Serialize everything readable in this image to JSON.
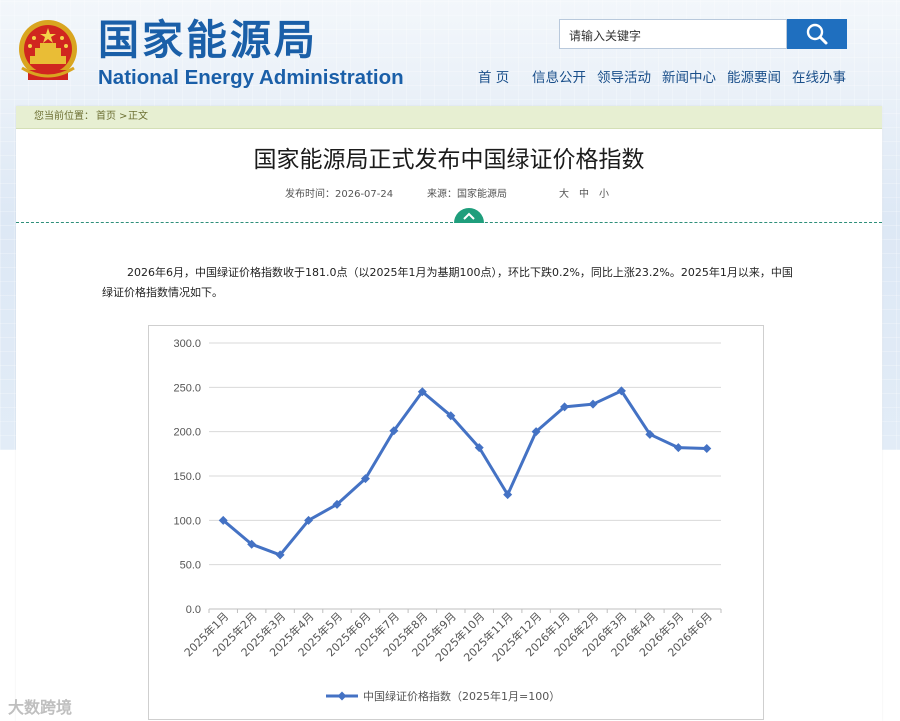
{
  "header": {
    "title_cn": "国家能源局",
    "title_en": "National Energy Administration",
    "emblem_icon": "national-emblem-icon",
    "search": {
      "placeholder": "请输入关键字",
      "button_icon": "search-icon"
    },
    "nav": [
      "首 页",
      "信息公开",
      "领导活动",
      "新闻中心",
      "能源要闻",
      "在线办事"
    ]
  },
  "breadcrumb": {
    "label": "您当前位置：",
    "items": [
      "首页",
      ">",
      "正文"
    ]
  },
  "article": {
    "title": "国家能源局正式发布中国绿证价格指数",
    "publish_time": "发布时间：2026-07-24",
    "source": "来源：国家能源局",
    "font_sizes": [
      "大",
      "中",
      "小"
    ],
    "intro_line1": "2026年6月，中国绿证价格指数收于181.0点（以2025年1月为基期100点），环比下跌0.2%，同比上涨23.2%。2025年1月以来，中国",
    "intro_line2": "绿证价格指数情况如下。"
  },
  "chart_data": {
    "type": "line",
    "x": [
      "2025年1月",
      "2025年2月",
      "2025年3月",
      "2025年4月",
      "2025年5月",
      "2025年6月",
      "2025年7月",
      "2025年8月",
      "2025年9月",
      "2025年10月",
      "2025年11月",
      "2025年12月",
      "2026年1月",
      "2026年2月",
      "2026年3月",
      "2026年4月",
      "2026年5月",
      "2026年6月"
    ],
    "series": [
      {
        "name": "中国绿证价格指数（2025年1月=100）",
        "values": [
          100,
          73,
          61,
          100,
          118,
          147,
          201,
          245,
          218,
          182,
          129,
          200,
          228,
          231,
          246,
          197,
          182,
          181
        ],
        "color": "#4472c4",
        "marker": "diamond"
      }
    ],
    "yticks": [
      "300.0",
      "250.0",
      "200.0",
      "150.0",
      "100.0",
      "50.0",
      "0.0"
    ],
    "ylim": [
      0,
      300
    ],
    "grid": true,
    "legend": "bottom"
  },
  "watermark": "大数跨境"
}
